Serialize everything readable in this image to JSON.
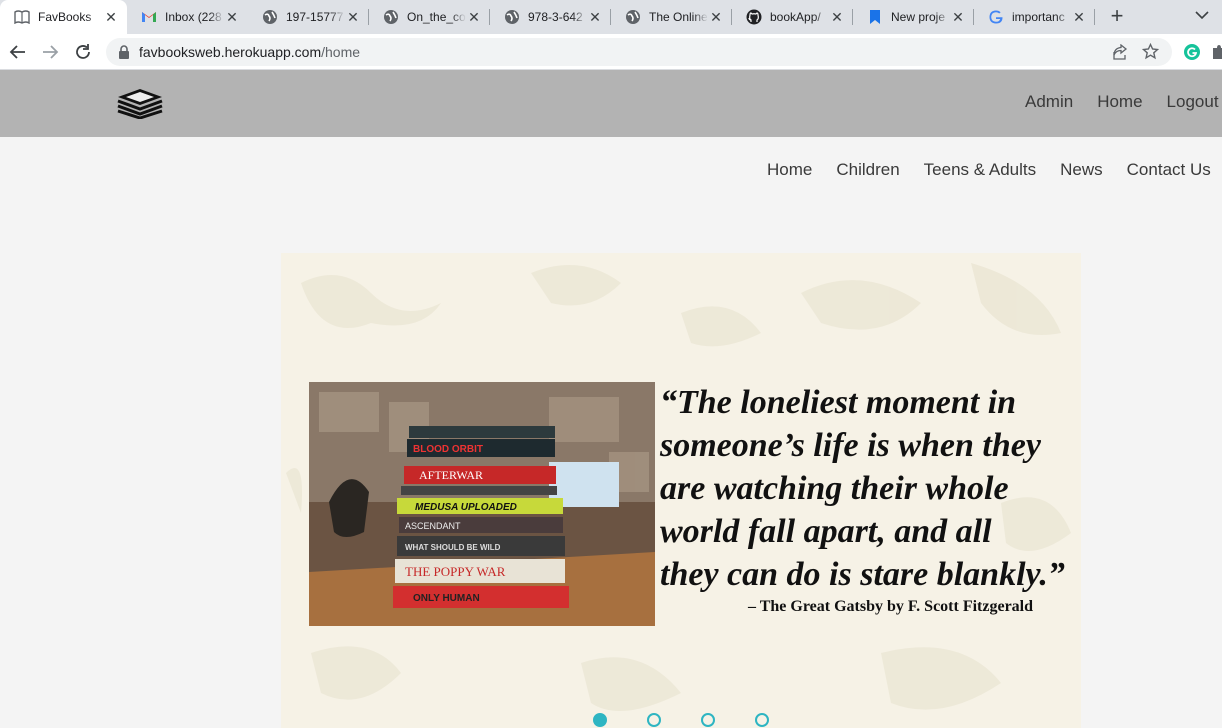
{
  "browser": {
    "tabs": [
      {
        "title": "FavBooks",
        "icon": "book-icon",
        "active": true
      },
      {
        "title": "Inbox (228",
        "icon": "gmail-icon"
      },
      {
        "title": "197-15777",
        "icon": "globe-icon"
      },
      {
        "title": "On_the_co",
        "icon": "globe-icon"
      },
      {
        "title": "978-3-642",
        "icon": "globe-icon"
      },
      {
        "title": "The Online",
        "icon": "globe-icon"
      },
      {
        "title": "bookApp/",
        "icon": "github-icon"
      },
      {
        "title": "New proje",
        "icon": "bookmark-icon"
      },
      {
        "title": "importanc",
        "icon": "google-icon"
      }
    ],
    "url": {
      "domain": "favbooksweb.herokuapp.com",
      "path": "/home"
    }
  },
  "header": {
    "logo_icon": "stacked-books-icon",
    "links": [
      "Admin",
      "Home",
      "Logout"
    ]
  },
  "nav": {
    "items": [
      "Home",
      "Children",
      "Teens & Adults",
      "News",
      "Contact Us"
    ]
  },
  "hero": {
    "image": "stack-of-books-photo",
    "book_spines": [
      "BLOOD ORBIT",
      "AFTERWAR",
      "MEDUSA UPLOADED",
      "ASCENDANT",
      "WHAT SHOULD BE WILD",
      "THE POPPY WAR",
      "ONLY HUMAN"
    ],
    "quote_lines": [
      "“The loneliest moment in",
      "someone’s life is when they",
      "are watching their whole",
      "world fall apart, and all",
      "they can do is stare blankly.”"
    ],
    "attribution": "– The Great Gatsby by F. Scott Fitzgerald"
  },
  "carousel": {
    "slide_count": 4,
    "active_index": 0,
    "accent": "#2eb5c2"
  }
}
